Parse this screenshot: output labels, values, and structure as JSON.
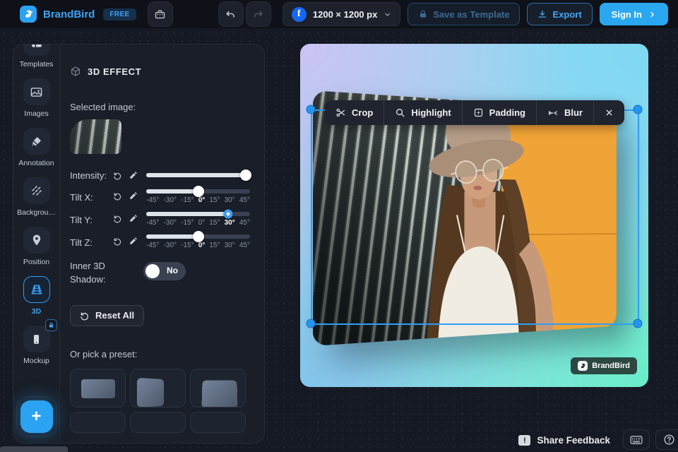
{
  "colors": {
    "accent": "#2f9df5",
    "brand_blue": "#3fa2f2",
    "canvas_gradient": [
      "#cac3f4",
      "#7fd8f3",
      "#69eec9",
      "#84c5ec"
    ],
    "photo_orange": "#f0a336"
  },
  "topbar": {
    "brand": "BrandBird",
    "plan_badge": "FREE",
    "size_label": "1200 × 1200 px",
    "save_template_label": "Save as Template",
    "export_label": "Export",
    "signin_label": "Sign In"
  },
  "sidebar": {
    "items": [
      {
        "label": "Templates",
        "icon": "template-icon",
        "active": false,
        "locked": false,
        "clipped": true
      },
      {
        "label": "Images",
        "icon": "image-icon",
        "active": false,
        "locked": false
      },
      {
        "label": "Annotation",
        "icon": "marker-icon",
        "active": false,
        "locked": false
      },
      {
        "label": "Backgrou…",
        "icon": "diagonal-lines-icon",
        "active": false,
        "locked": false
      },
      {
        "label": "Position",
        "icon": "pin-icon",
        "active": false,
        "locked": false
      },
      {
        "label": "3D",
        "icon": "perspective-grid-icon",
        "active": true,
        "locked": false
      },
      {
        "label": "Mockup",
        "icon": "phone-icon",
        "active": false,
        "locked": true
      }
    ],
    "add_button": "+"
  },
  "panel": {
    "title": "3D EFFECT",
    "selected_image_label": "Selected image:",
    "sliders": [
      {
        "label": "Intensity:",
        "value_pct": 96,
        "ticks": [],
        "active_tick": -1,
        "focused": false
      },
      {
        "label": "Tilt X:",
        "value_pct": 50,
        "ticks": [
          "-45°",
          "-30°",
          "-15°",
          "0°",
          "15°",
          "30°",
          "45°"
        ],
        "active_tick": 3,
        "focused": false
      },
      {
        "label": "Tilt Y:",
        "value_pct": 79,
        "ticks": [
          "-45°",
          "-30°",
          "-15°",
          "0°",
          "15°",
          "30°",
          "45°"
        ],
        "active_tick": 5,
        "focused": true
      },
      {
        "label": "Tilt Z:",
        "value_pct": 50,
        "ticks": [
          "-45°",
          "-30°",
          "-15°",
          "0°",
          "15°",
          "30°",
          "45°"
        ],
        "active_tick": 3,
        "focused": false
      }
    ],
    "shadow_label_line1": "Inner 3D",
    "shadow_label_line2": "Shadow:",
    "shadow_value": "No",
    "reset_all_label": "Reset All",
    "preset_label": "Or pick a preset:",
    "presets": [
      "preset-flat",
      "preset-tilted",
      "preset-raised"
    ]
  },
  "canvas": {
    "toolbar": [
      {
        "label": "Crop",
        "icon": "scissors-icon"
      },
      {
        "label": "Highlight",
        "icon": "magnifier-icon"
      },
      {
        "label": "Padding",
        "icon": "padding-icon"
      },
      {
        "label": "Blur",
        "icon": "blur-icon"
      }
    ],
    "close_label": "×",
    "watermark": "BrandBird"
  },
  "footer": {
    "feedback_label": "Share Feedback"
  }
}
